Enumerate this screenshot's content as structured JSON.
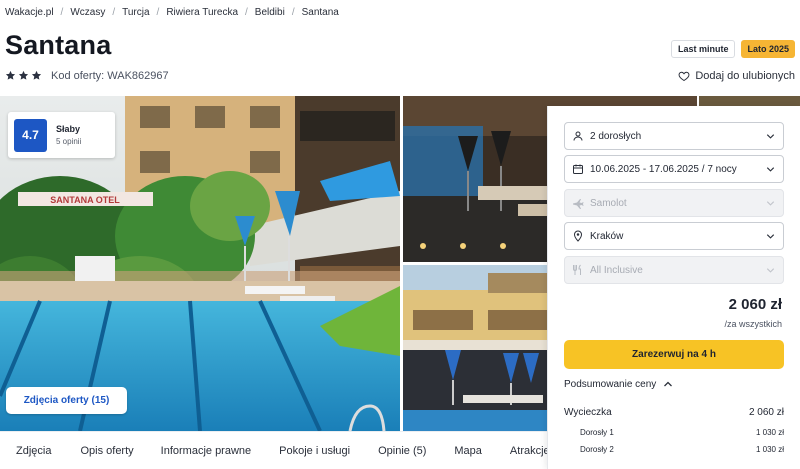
{
  "breadcrumb": [
    "Wakacje.pl",
    "Wczasy",
    "Turcja",
    "Riwiera Turecka",
    "Beldibi",
    "Santana"
  ],
  "hotel": {
    "name": "Santana",
    "stars": 3,
    "offer_code": "Kod oferty: WAK862967"
  },
  "badges": {
    "last_minute": "Last minute",
    "season": "Lato 2025"
  },
  "favorite_label": "Dodaj do ulubionych",
  "rating": {
    "score": "4.7",
    "label": "Słaby",
    "count": "5 opinii"
  },
  "photos_button": "Zdjęcia oferty (15)",
  "tabs": [
    "Zdjęcia",
    "Opis oferty",
    "Informacje prawne",
    "Pokoje i usługi",
    "Opinie (5)",
    "Mapa",
    "Atrakcje"
  ],
  "booking": {
    "guests": "2 dorosłych",
    "dates": "10.06.2025 - 17.06.2025 / 7 nocy",
    "transport": "Samolot",
    "departure": "Kraków",
    "board": "All Inclusive",
    "price": "2 060 zł",
    "price_note": "/za wszystkich",
    "book_label": "Zarezerwuj na 4 h",
    "summary_label": "Podsumowanie ceny",
    "summary": {
      "trip_label": "Wycieczka",
      "trip_value": "2 060 zł",
      "adult1_label": "Dorosły 1",
      "adult1_value": "1 030 zł",
      "adult2_label": "Dorosły 2",
      "adult2_value": "1 030 zł"
    }
  },
  "pool_sign": "SANTANA OTEL",
  "colors": {
    "brand_blue": "#1d57c4",
    "accent_yellow": "#f7c325",
    "season_orange": "#f6b534"
  }
}
